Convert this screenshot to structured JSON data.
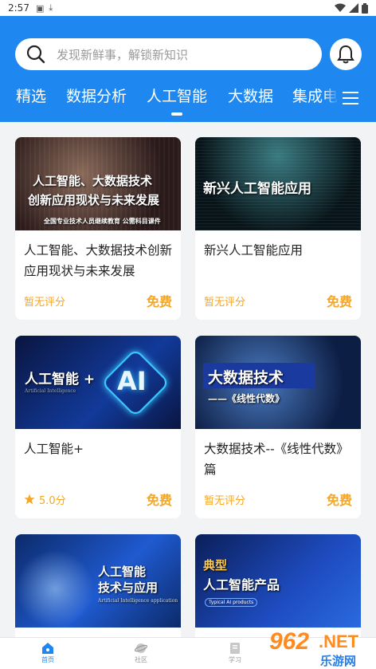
{
  "status_bar": {
    "time": "2:57",
    "icons_left": [
      "a-icon",
      "download-icon"
    ],
    "icons_right": [
      "wifi-icon",
      "signal-icon",
      "battery-icon"
    ]
  },
  "search": {
    "placeholder": "发现新鲜事，解锁新知识"
  },
  "tabs": [
    {
      "label": "精选"
    },
    {
      "label": "数据分析"
    },
    {
      "label": "人工智能",
      "active": true
    },
    {
      "label": "大数据"
    },
    {
      "label": "集成电"
    }
  ],
  "courses": [
    {
      "title": "人工智能、大数据技术创新应用现状与未来发展",
      "rating": "暂无评分",
      "price": "免费",
      "thumb": {
        "line1": "人工智能、大数据技术",
        "line2": "创新应用现状与未来发展",
        "footer": "全国专业技术人员继续教育 公需科目课件"
      }
    },
    {
      "title": "新兴人工智能应用",
      "rating": "暂无评分",
      "price": "免费",
      "thumb": {
        "line1": "新兴人工智能应用"
      }
    },
    {
      "title": "人工智能+",
      "rating": "5.0分",
      "price": "免费",
      "thumb": {
        "line1": "人工智能 +",
        "sub": "Artificial Intelligence",
        "badge": "AI"
      }
    },
    {
      "title": "大数据技术--《线性代数》篇",
      "rating": "暂无评分",
      "price": "免费",
      "thumb": {
        "line1": "大数据技术",
        "line2": "——《线性代数》"
      }
    },
    {
      "title": "",
      "rating": "",
      "price": "",
      "thumb": {
        "line1": "人工智能",
        "line2": "技术与应用",
        "sub": "Artificial Intelligence application"
      }
    },
    {
      "title": "",
      "rating": "",
      "price": "",
      "thumb": {
        "line0": "典型",
        "line1": "人工智能产品",
        "sub": "Typical AI products"
      }
    }
  ],
  "bottom_nav": [
    {
      "label": "首页",
      "icon": "home-icon",
      "active": true
    },
    {
      "label": "社区",
      "icon": "planet-icon",
      "active": false
    },
    {
      "label": "学习",
      "icon": "book-icon",
      "active": false
    }
  ],
  "watermark": {
    "brand": "962",
    "suffix": ".NET",
    "sub": "乐游网"
  },
  "colors": {
    "primary": "#1e88f0",
    "accent": "#f5a623",
    "background": "#f2f3f5"
  }
}
